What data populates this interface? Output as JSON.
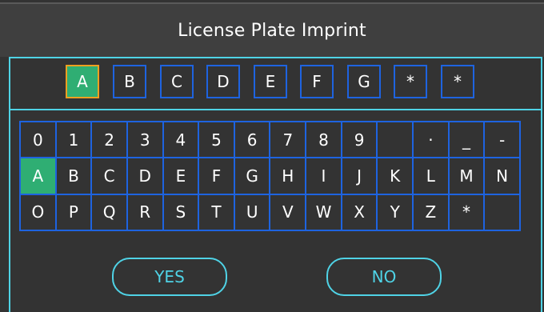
{
  "dialog": {
    "title": "License Plate Imprint"
  },
  "plate": {
    "slots": [
      "A",
      "B",
      "C",
      "D",
      "E",
      "F",
      "G",
      "*",
      "*"
    ],
    "active_index": 0
  },
  "keyboard": {
    "rows": [
      [
        "0",
        "1",
        "2",
        "3",
        "4",
        "5",
        "6",
        "7",
        "8",
        "9",
        "",
        "·",
        "_",
        "-"
      ],
      [
        "A",
        "B",
        "C",
        "D",
        "E",
        "F",
        "G",
        "H",
        "I",
        "J",
        "K",
        "L",
        "M",
        "N"
      ],
      [
        "O",
        "P",
        "Q",
        "R",
        "S",
        "T",
        "U",
        "V",
        "W",
        "X",
        "Y",
        "Z",
        "*",
        ""
      ]
    ],
    "selected_key": "A"
  },
  "buttons": {
    "yes_label": "YES",
    "no_label": "NO"
  },
  "colors": {
    "accent": "#4fd3e6",
    "grid_border": "#1e63e0",
    "selected_fill": "#2fae73",
    "active_slot_border": "#f0a020"
  }
}
